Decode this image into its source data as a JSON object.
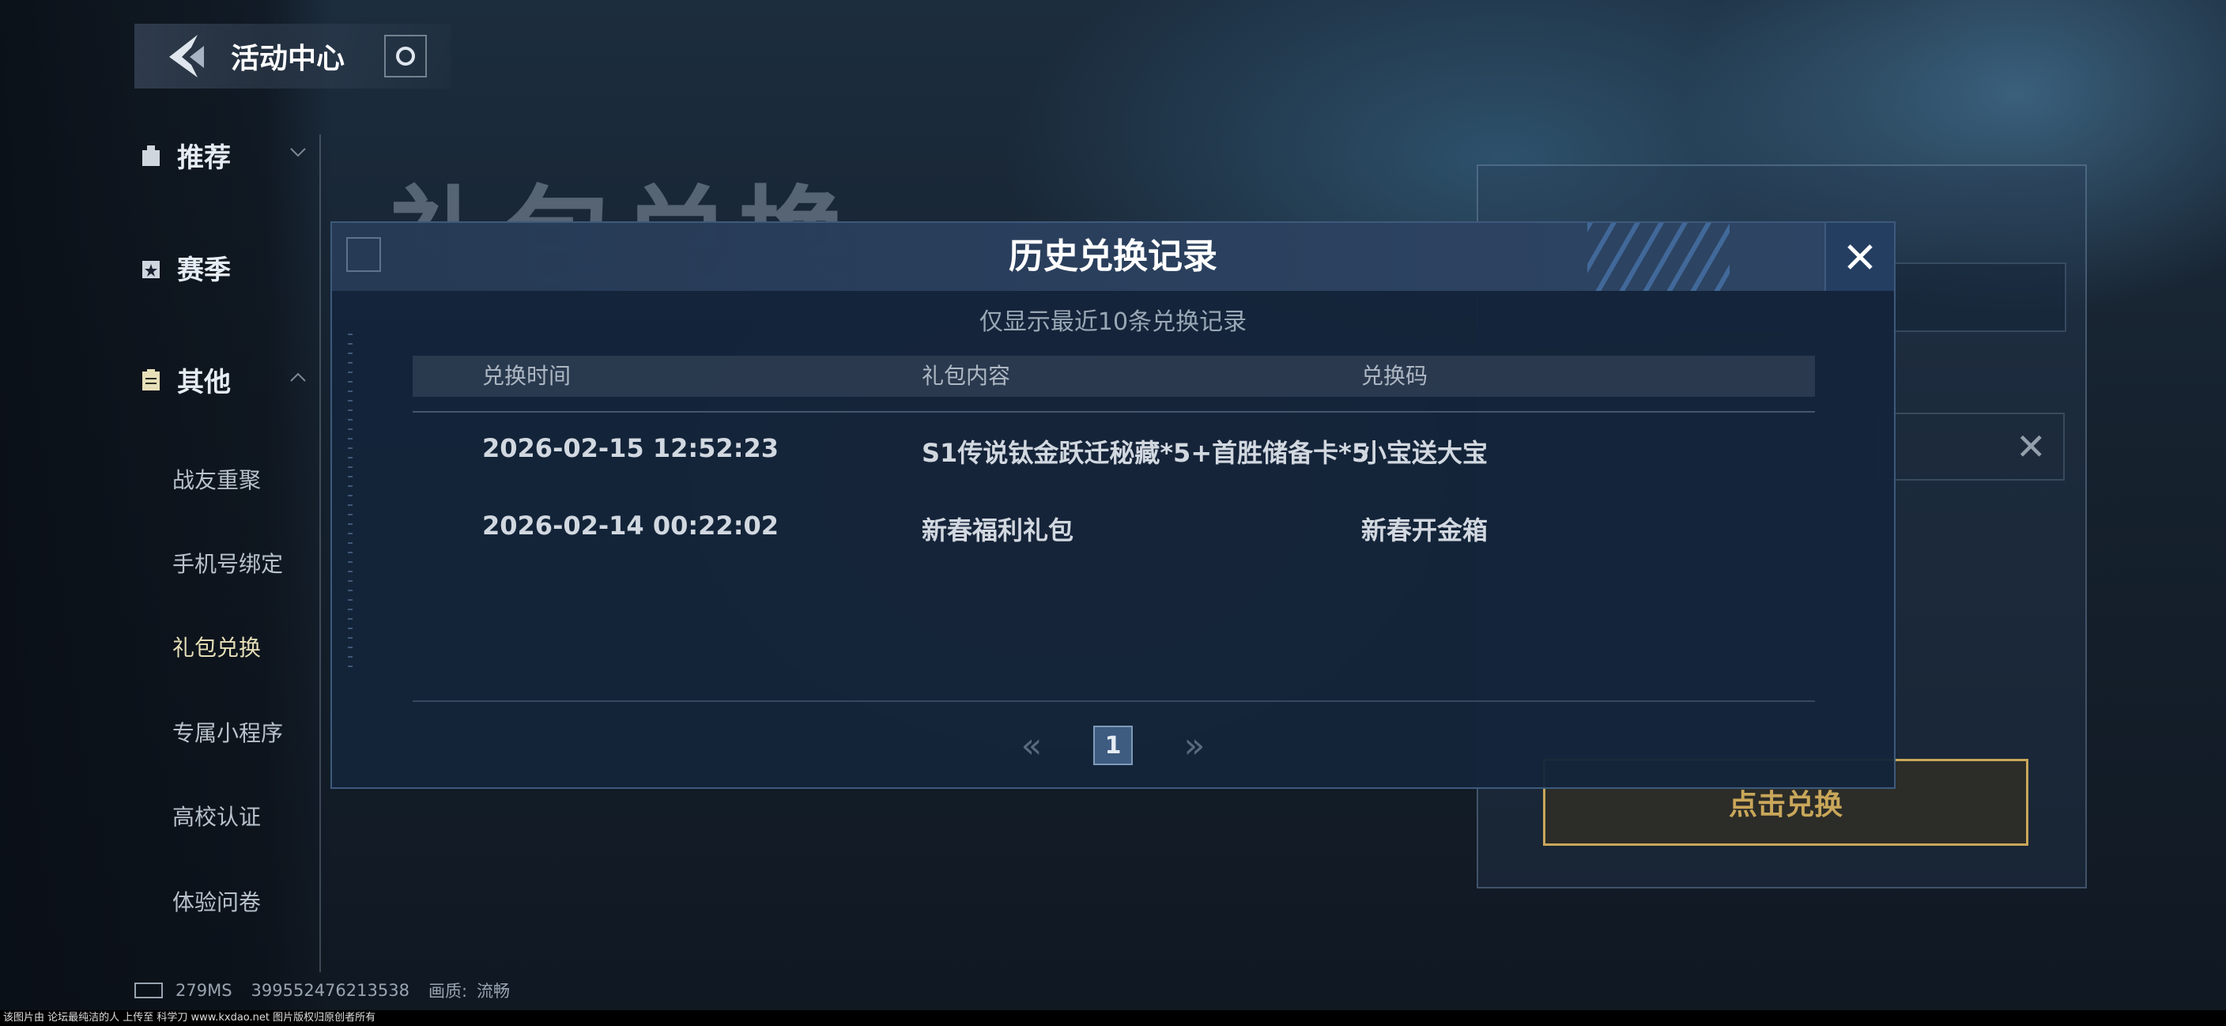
{
  "header": {
    "title": "活动中心"
  },
  "sidebar": {
    "categories": [
      {
        "label": "推荐",
        "icon": "gift-icon",
        "expanded": false
      },
      {
        "label": "赛季",
        "icon": "season-star-icon",
        "expanded": false
      },
      {
        "label": "其他",
        "icon": "clipboard-icon",
        "expanded": true
      }
    ],
    "items": [
      "战友重聚",
      "手机号绑定",
      "礼包兑换",
      "专属小程序",
      "高校认证",
      "体验问卷"
    ],
    "active_item": "礼包兑换"
  },
  "background": {
    "page_title": "礼包兑换",
    "redeem_button": "点击兑换"
  },
  "modal": {
    "title": "历史兑换记录",
    "subtitle": "仅显示最近10条兑换记录",
    "columns": [
      "兑换时间",
      "礼包内容",
      "兑换码"
    ],
    "rows": [
      [
        "2026-02-15 12:52:23",
        "S1传说钛金跃迁秘藏*5+首胜储备卡*5",
        "小宝送大宝"
      ],
      [
        "2026-02-14 00:22:02",
        "新春福利礼包",
        "新春开金箱"
      ]
    ],
    "pagination": {
      "current_page": "1",
      "prev": "«",
      "next": "»"
    }
  },
  "status_bar": {
    "ping": "279MS",
    "user_id": "399552476213538",
    "quality_label": "画质:",
    "quality_value": "流畅"
  },
  "watermark": "该图片由 论坛最纯洁的人 上传至 科学刀 www.kxdao.net 图片版权归原创者所有",
  "colors": {
    "accent_gold": "#c9a75a",
    "modal_bg": "#14243a",
    "pager_active": "#3e5b80"
  }
}
